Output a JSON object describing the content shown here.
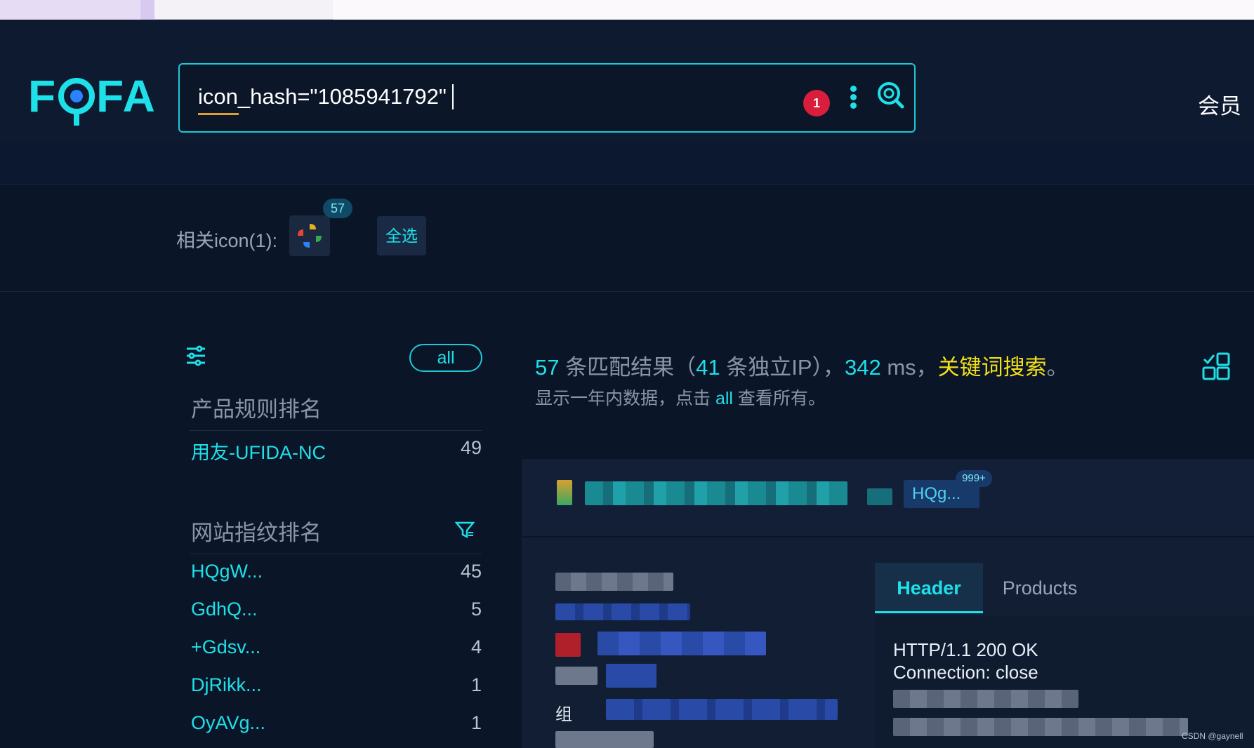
{
  "logo": {
    "text_f": "F",
    "text_fa": "FA"
  },
  "search": {
    "query": "icon_hash=\"1085941792\"",
    "error_count": "1"
  },
  "nav": {
    "member": "会员"
  },
  "related_icons": {
    "label": "相关icon(1):",
    "count": "57",
    "select_all": "全选"
  },
  "left_panel": {
    "all_label": "all",
    "product_title": "产品规则排名",
    "products": [
      {
        "name": "用友-UFIDA-NC",
        "count": "49"
      }
    ],
    "fingerprint_title": "网站指纹排名",
    "fingerprints": [
      {
        "name": "HQgW...",
        "count": "45"
      },
      {
        "name": "GdhQ...",
        "count": "5"
      },
      {
        "name": "+Gdsv...",
        "count": "4"
      },
      {
        "name": "DjRikk...",
        "count": "1"
      },
      {
        "name": "OyAVg...",
        "count": "1"
      }
    ]
  },
  "summary": {
    "total": "57",
    "t1": " 条匹配结果（",
    "unique_ip": "41",
    "t2": " 条独立IP），",
    "ms": "342",
    "t3": " ms，",
    "keyword": "关键词搜索",
    "t4": "。",
    "line2_a": "显示一年内数据，点击 ",
    "line2_all": "all",
    "line2_b": " 查看所有。"
  },
  "result": {
    "chip": "HQg...",
    "chip_count": "999+",
    "tabs": {
      "header": "Header",
      "products": "Products"
    },
    "http_status": "HTTP/1.1 200 OK",
    "http_connection": "Connection: close",
    "row_label": "组"
  },
  "watermark": "CSDN @gaynell"
}
